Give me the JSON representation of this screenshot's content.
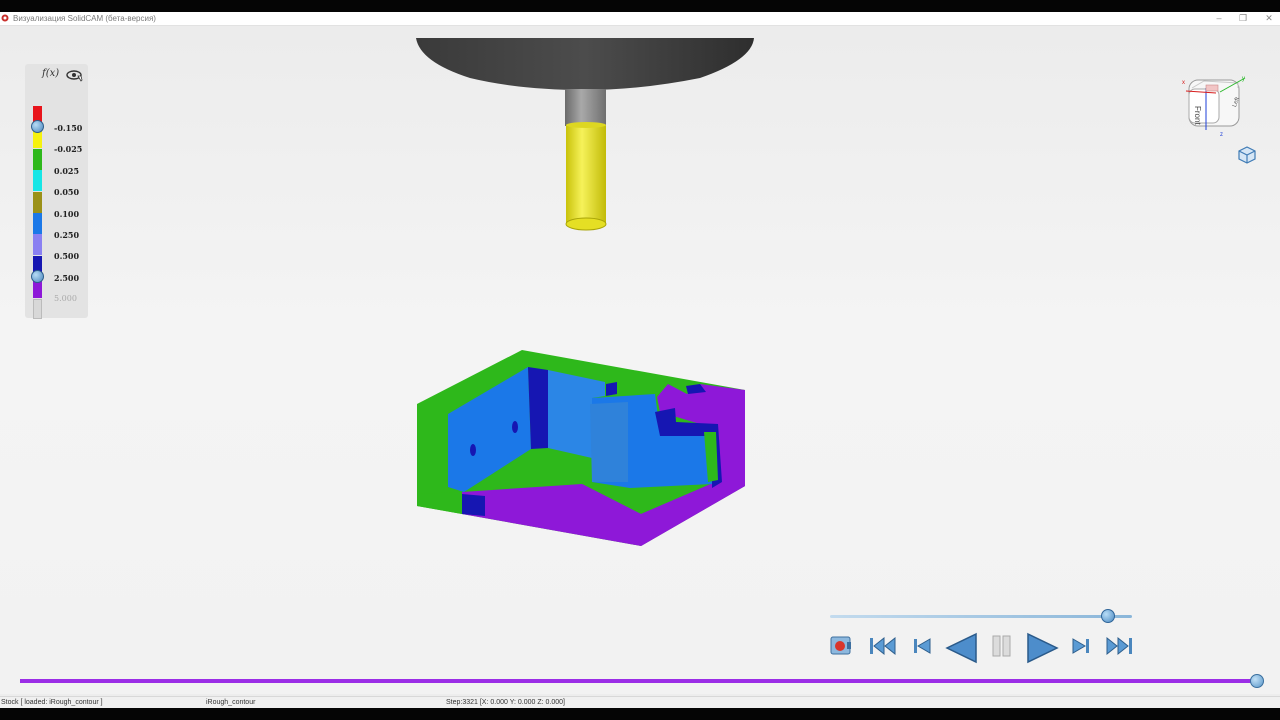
{
  "window": {
    "title": "Визуализация SolidCAM (бета-версия)",
    "controls": [
      "–",
      "❐",
      "✕"
    ]
  },
  "legend": {
    "fx_label": "f(x)",
    "entries": [
      {
        "value": "-0.150",
        "color": "#e8141b"
      },
      {
        "value": "-0.025",
        "color": "#f6f20e"
      },
      {
        "value": "0.025",
        "color": "#2eb81b"
      },
      {
        "value": "0.050",
        "color": "#17e6e6"
      },
      {
        "value": "0.100",
        "color": "#9b9118"
      },
      {
        "value": "0.250",
        "color": "#1b78e8"
      },
      {
        "value": "0.500",
        "color": "#8a80f2"
      },
      {
        "value": "2.500",
        "color": "#1616b2"
      },
      {
        "value": "5.000",
        "color": "#8e18d8"
      }
    ],
    "last_swatch_color": "#d8d8d8"
  },
  "view_cube": {
    "front_label": "Front",
    "left_label": "Left",
    "axes": [
      "x",
      "y",
      "z"
    ]
  },
  "playback": {
    "speed_level": 0.92,
    "progress_level": 1.0,
    "buttons": [
      "record-button",
      "rewind-to-start-button",
      "step-back-button",
      "play-reverse-button",
      "pause-button",
      "play-button",
      "step-forward-button",
      "fast-forward-to-end-button"
    ]
  },
  "status": {
    "left": "Stock [ loaded: iRough_contour ]",
    "operation": "iRough_contour",
    "step": "Step:3321 [X: 0.000 Y: 0.000 Z: 0.000]"
  },
  "colors": {
    "progress": "#9b2de6",
    "accent": "#4a86bd"
  }
}
